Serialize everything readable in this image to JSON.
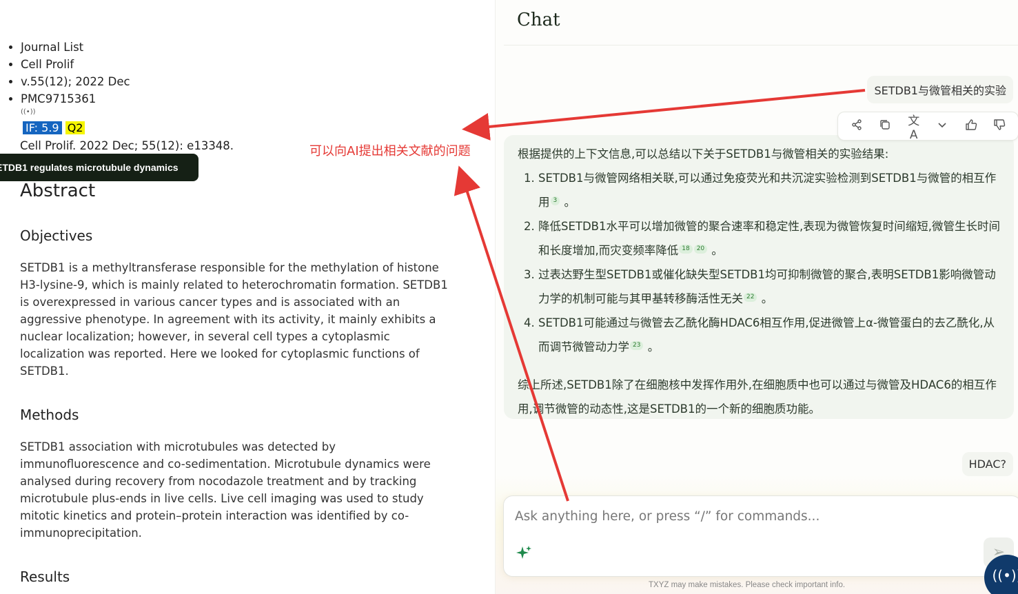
{
  "article": {
    "breadcrumbs": [
      "Journal List",
      "Cell Prolif",
      "v.55(12); 2022 Dec",
      "PMC9715361"
    ],
    "impact_factor": "IF: 5.9",
    "quartile": "Q2",
    "citation": "Cell Prolif. 2022 Dec; 55(12): e13348.",
    "tooltip": "ETDB1 regulates microtubule dynamics",
    "abstract_heading": "Abstract",
    "objectives_heading": "Objectives",
    "objectives_text": "SETDB1 is a methyltransferase responsible for the methylation of histone H3-lysine-9, which is mainly related to heterochromatin formation. SETDB1 is overexpressed in various cancer types and is associated with an aggressive phenotype. In agreement with its activity, it mainly exhibits a nuclear localization; however, in several cell types a cytoplasmic localization was reported. Here we looked for cytoplasmic functions of SETDB1.",
    "methods_heading": "Methods",
    "methods_text": "SETDB1 association with microtubules was detected by immunofluorescence and co-sedimentation. Microtubule dynamics were analysed during recovery from nocodazole treatment and by tracking microtubule plus-ends in live cells. Live cell imaging was used to study mitotic kinetics and protein–protein interaction was identified by co-immunoprecipitation.",
    "results_heading": "Results"
  },
  "annotation": {
    "label": "可以向AI提出相关文献的问题",
    "color": "#e53935"
  },
  "chat": {
    "title": "Chat",
    "user_message_1": "SETDB1与微管相关的实验",
    "answer": {
      "intro": "根据提供的上下文信息,可以总结以下关于SETDB1与微管相关的实验结果:",
      "item1": "SETDB1与微管网络相关联,可以通过免疫荧光和共沉淀实验检测到SETDB1与微管的相互作用",
      "item1_cite": "3",
      "item2": "降低SETDB1水平可以增加微管的聚合速率和稳定性,表现为微管恢复时间缩短,微管生长时间和长度增加,而灾变频率降低",
      "item2_cite_a": "18",
      "item2_cite_b": "20",
      "item3": "过表达野生型SETDB1或催化缺失型SETDB1均可抑制微管的聚合,表明SETDB1影响微管动力学的机制可能与其甲基转移酶活性无关",
      "item3_cite": "22",
      "item4": "SETDB1可能通过与微管去乙酰化酶HDAC6相互作用,促进微管上α-微管蛋白的去乙酰化,从而调节微管动力学",
      "item4_cite": "23",
      "end_mark": "。",
      "summary": "综上所述,SETDB1除了在细胞核中发挥作用外,在细胞质中也可以通过与微管及HDAC6的相互作用,调节微管的动态性,这是SETDB1的一个新的细胞质功能。"
    },
    "user_message_2": "HDAC?",
    "input_placeholder": "Ask anything here, or press “/” for commands...",
    "disclaimer": "TXYZ may make mistakes. Please check important info.",
    "icons": [
      "share-icon",
      "copy-icon",
      "translate-icon",
      "chevron-down-icon",
      "thumbs-up-icon",
      "thumbs-down-icon",
      "sparkle-icon",
      "send-icon",
      "radio-icon"
    ]
  }
}
